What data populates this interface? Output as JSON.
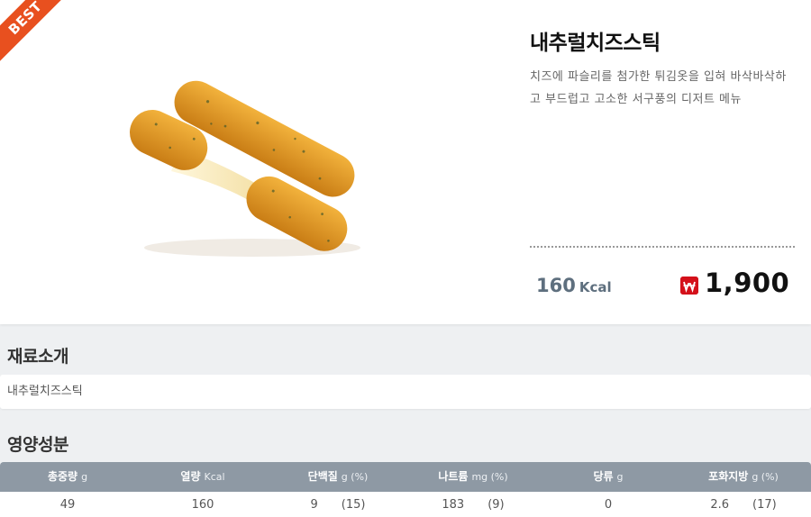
{
  "badge": {
    "label": "BEST",
    "color": "#e8501f"
  },
  "product": {
    "name": "내추럴치즈스틱",
    "description": "치즈에 파슬리를 첨가한 튀김옷을 입혀 바삭바삭하고 부드럽고 고소한 서구풍의 디저트 메뉴",
    "kcal_value": "160",
    "kcal_unit": "Kcal",
    "price_icon": "won-badge-icon",
    "price": "1,900"
  },
  "ingredients": {
    "title": "재료소개",
    "text": "내추럴치즈스틱"
  },
  "nutrition": {
    "title": "영양성분",
    "headers": [
      {
        "label": "총중량",
        "unit": "g"
      },
      {
        "label": "열량",
        "unit": "Kcal"
      },
      {
        "label": "단백질",
        "unit": "g (%)"
      },
      {
        "label": "나트륨",
        "unit": "mg (%)"
      },
      {
        "label": "당류",
        "unit": "g"
      },
      {
        "label": "포화지방",
        "unit": "g (%)"
      }
    ],
    "values": [
      {
        "value": "49",
        "pct": ""
      },
      {
        "value": "160",
        "pct": ""
      },
      {
        "value": "9",
        "pct": "(15)"
      },
      {
        "value": "183",
        "pct": "(9)"
      },
      {
        "value": "0",
        "pct": ""
      },
      {
        "value": "2.6",
        "pct": "(17)"
      }
    ]
  },
  "colors": {
    "accent_price": "#d4101a",
    "table_header": "#8e99a4",
    "kcal_text": "#5e6f7e"
  }
}
